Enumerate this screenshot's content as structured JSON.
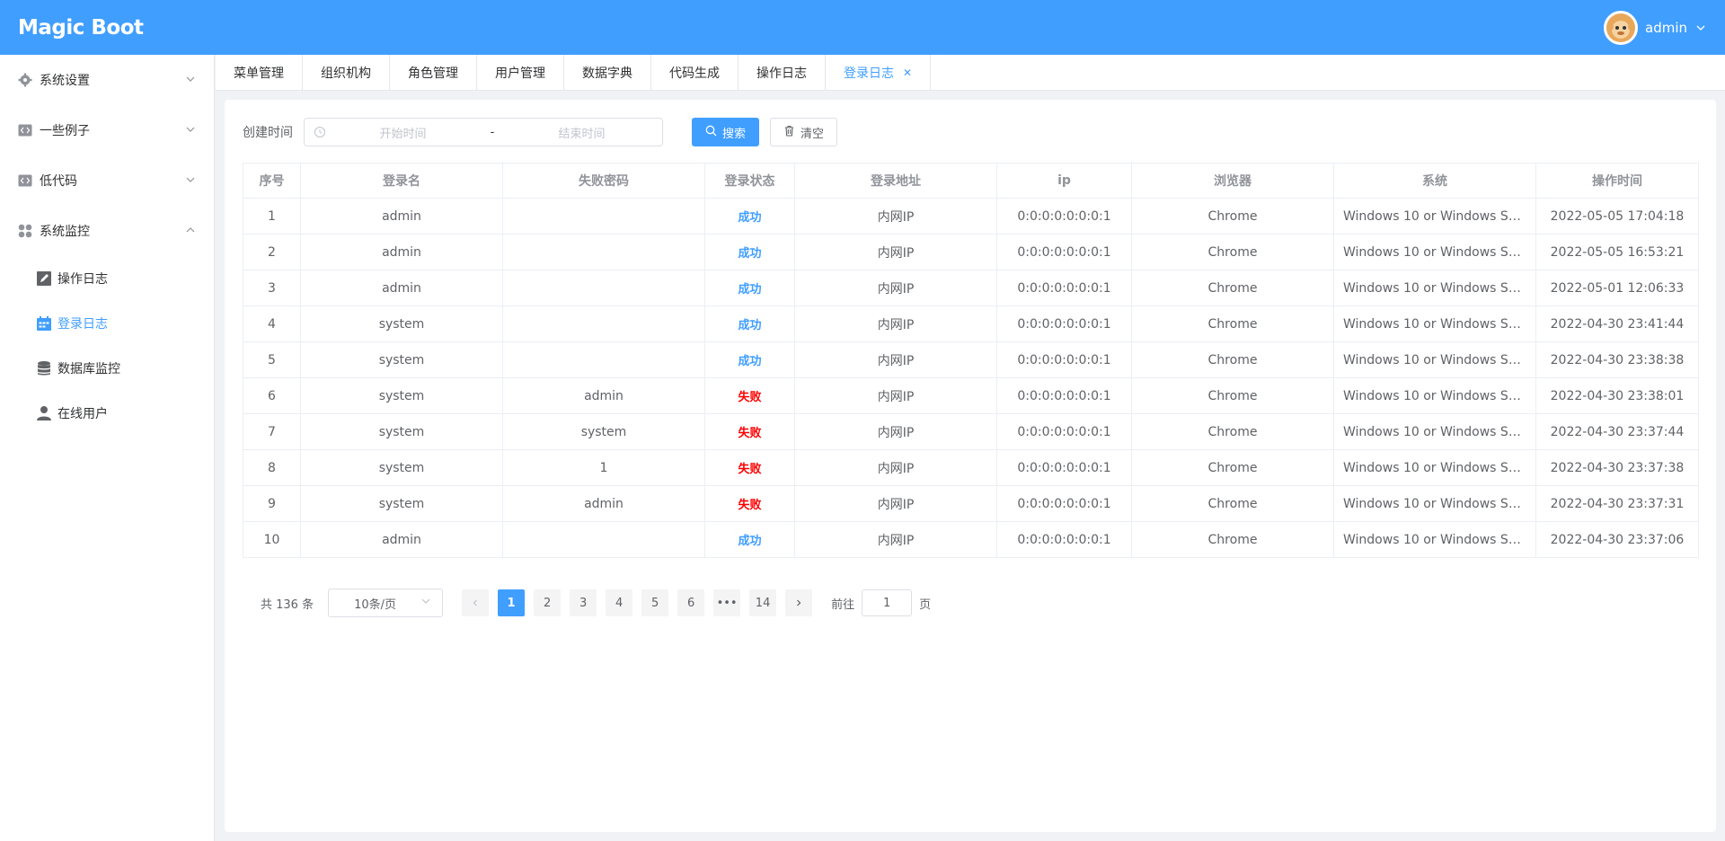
{
  "header": {
    "logo": "Magic Boot",
    "username": "admin"
  },
  "sidebar": {
    "menus": [
      {
        "label": "系统设置",
        "icon": "gear-icon",
        "expanded": false
      },
      {
        "label": "一些例子",
        "icon": "code-icon",
        "expanded": false
      },
      {
        "label": "低代码",
        "icon": "code-icon",
        "expanded": false
      },
      {
        "label": "系统监控",
        "icon": "grid-icon",
        "expanded": true
      }
    ],
    "sub_items": [
      {
        "label": "操作日志",
        "icon": "edit-icon",
        "active": false
      },
      {
        "label": "登录日志",
        "icon": "calendar-icon",
        "active": true
      },
      {
        "label": "数据库监控",
        "icon": "database-icon",
        "active": false
      },
      {
        "label": "在线用户",
        "icon": "user-icon",
        "active": false
      }
    ]
  },
  "tabs": [
    "菜单管理",
    "组织机构",
    "角色管理",
    "用户管理",
    "数据字典",
    "代码生成",
    "操作日志",
    "登录日志"
  ],
  "filter": {
    "label": "创建时间",
    "start_placeholder": "开始时间",
    "separator": "-",
    "end_placeholder": "结束时间",
    "search_label": "搜索",
    "clear_label": "清空"
  },
  "table": {
    "columns": [
      "序号",
      "登录名",
      "失败密码",
      "登录状态",
      "登录地址",
      "ip",
      "浏览器",
      "系统",
      "操作时间"
    ],
    "rows": [
      [
        "1",
        "admin",
        "",
        "成功",
        "内网IP",
        "0:0:0:0:0:0:0:1",
        "Chrome",
        "Windows 10 or Windows Se...",
        "2022-05-05 17:04:18"
      ],
      [
        "2",
        "admin",
        "",
        "成功",
        "内网IP",
        "0:0:0:0:0:0:0:1",
        "Chrome",
        "Windows 10 or Windows Se...",
        "2022-05-05 16:53:21"
      ],
      [
        "3",
        "admin",
        "",
        "成功",
        "内网IP",
        "0:0:0:0:0:0:0:1",
        "Chrome",
        "Windows 10 or Windows Se...",
        "2022-05-01 12:06:33"
      ],
      [
        "4",
        "system",
        "",
        "成功",
        "内网IP",
        "0:0:0:0:0:0:0:1",
        "Chrome",
        "Windows 10 or Windows Se...",
        "2022-04-30 23:41:44"
      ],
      [
        "5",
        "system",
        "",
        "成功",
        "内网IP",
        "0:0:0:0:0:0:0:1",
        "Chrome",
        "Windows 10 or Windows Se...",
        "2022-04-30 23:38:38"
      ],
      [
        "6",
        "system",
        "admin",
        "失败",
        "内网IP",
        "0:0:0:0:0:0:0:1",
        "Chrome",
        "Windows 10 or Windows Se...",
        "2022-04-30 23:38:01"
      ],
      [
        "7",
        "system",
        "system",
        "失败",
        "内网IP",
        "0:0:0:0:0:0:0:1",
        "Chrome",
        "Windows 10 or Windows Se...",
        "2022-04-30 23:37:44"
      ],
      [
        "8",
        "system",
        "1",
        "失败",
        "内网IP",
        "0:0:0:0:0:0:0:1",
        "Chrome",
        "Windows 10 or Windows Se...",
        "2022-04-30 23:37:38"
      ],
      [
        "9",
        "system",
        "admin",
        "失败",
        "内网IP",
        "0:0:0:0:0:0:0:1",
        "Chrome",
        "Windows 10 or Windows Se...",
        "2022-04-30 23:37:31"
      ],
      [
        "10",
        "admin",
        "",
        "成功",
        "内网IP",
        "0:0:0:0:0:0:0:1",
        "Chrome",
        "Windows 10 or Windows Se...",
        "2022-04-30 23:37:06"
      ]
    ]
  },
  "pagination": {
    "total": "共 136 条",
    "page_size": "10条/页",
    "pages": [
      "1",
      "2",
      "3",
      "4",
      "5",
      "6",
      "•••",
      "14"
    ],
    "current": "1",
    "jump_prefix": "前往",
    "jump_value": "1",
    "jump_suffix": "页"
  },
  "colors": {
    "primary": "#409eff",
    "success_text": "#409eff",
    "fail_text": "#ff0000"
  }
}
